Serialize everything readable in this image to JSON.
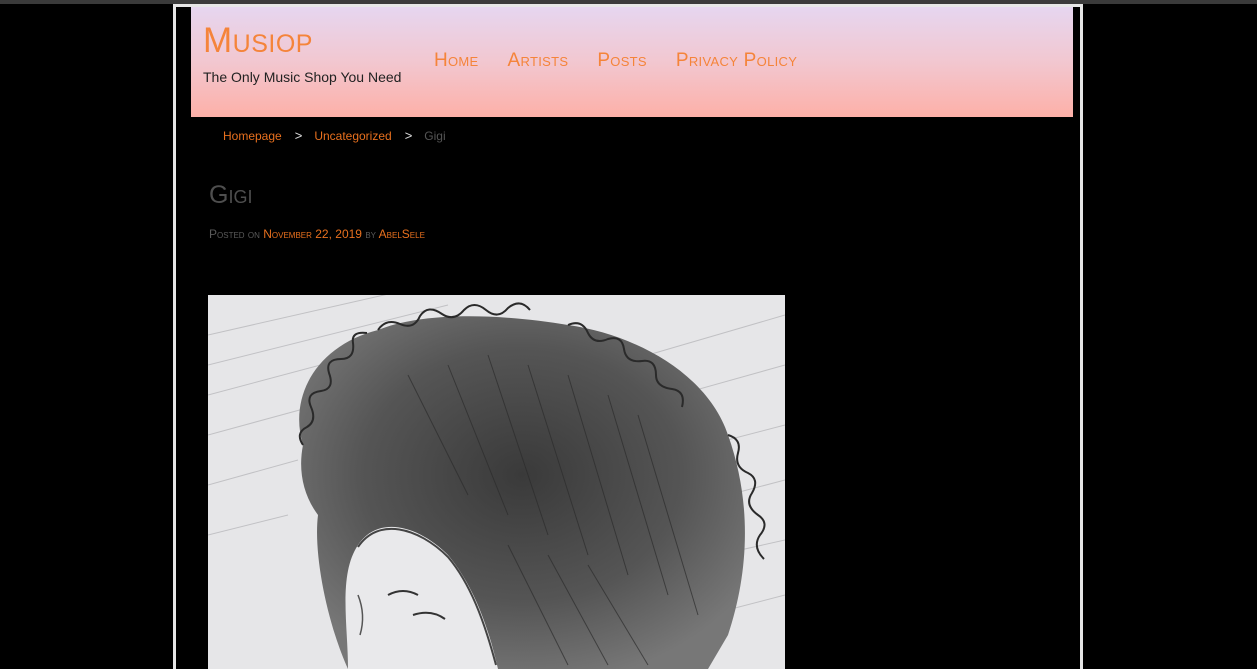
{
  "site": {
    "title": "Musiop",
    "tagline": "The Only Music Shop You Need"
  },
  "nav": {
    "items": [
      {
        "label": "Home"
      },
      {
        "label": "Artists"
      },
      {
        "label": "Posts"
      },
      {
        "label": "Privacy Policy"
      }
    ]
  },
  "breadcrumb": {
    "home": "Homepage",
    "category": "Uncategorized",
    "current": "Gigi",
    "separator": ">"
  },
  "post": {
    "title": "Gigi",
    "posted_on_label": "Posted on",
    "date": "November 22, 2019",
    "by_label": "by",
    "author": "AbelSele"
  },
  "colors": {
    "accent": "#f5843a",
    "link": "#e8701e",
    "background": "#000000"
  }
}
